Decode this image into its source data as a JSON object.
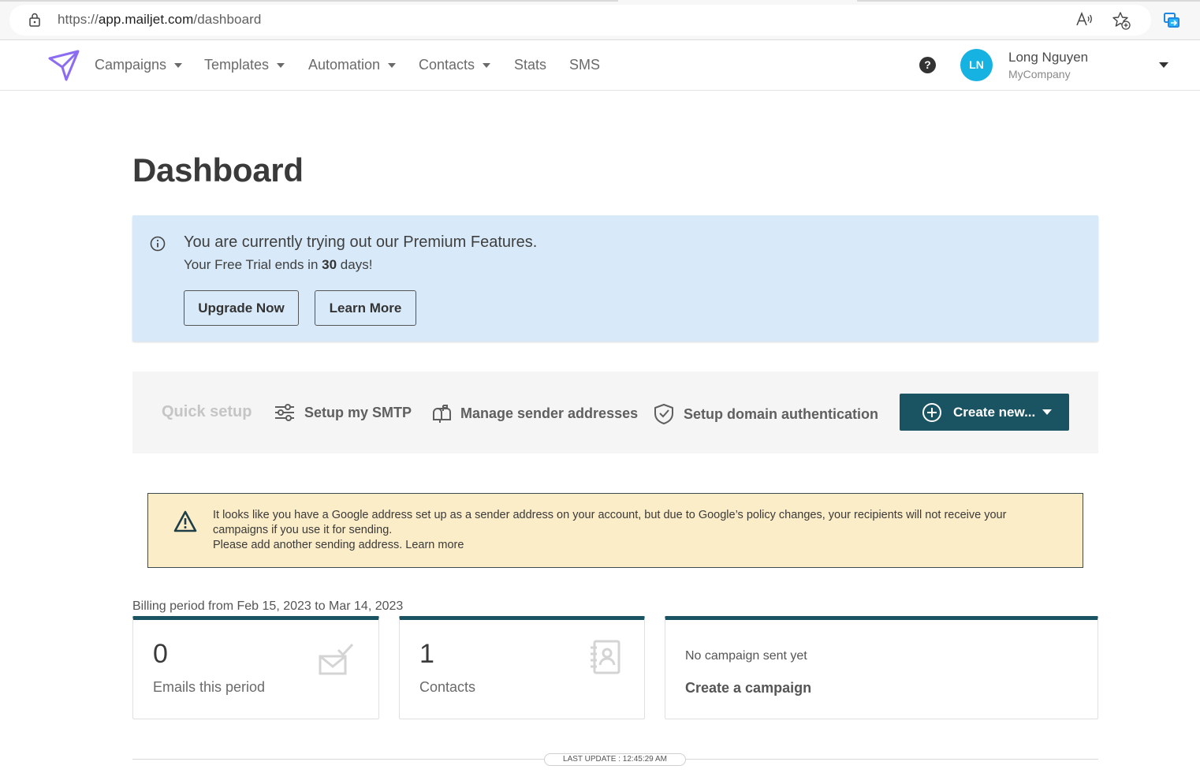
{
  "browser": {
    "url_scheme": "https://",
    "url_domain": "app.mailjet.com",
    "url_path": "/dashboard",
    "icons": [
      "lock-icon",
      "read-aloud-icon",
      "add-favorite-icon",
      "extension-icon"
    ]
  },
  "nav": {
    "items": [
      {
        "label": "Campaigns",
        "dropdown": true
      },
      {
        "label": "Templates",
        "dropdown": true
      },
      {
        "label": "Automation",
        "dropdown": true
      },
      {
        "label": "Contacts",
        "dropdown": true
      },
      {
        "label": "Stats",
        "dropdown": false
      },
      {
        "label": "SMS",
        "dropdown": false
      }
    ],
    "help_glyph": "?",
    "user": {
      "initials": "LN",
      "name": "Long Nguyen",
      "company": "MyCompany"
    },
    "brand_color": "#8c6cf0",
    "avatar_color": "#15b2e2"
  },
  "page": {
    "title": "Dashboard"
  },
  "premium": {
    "title": "You are currently trying out our Premium Features.",
    "sub_prefix": "Your Free Trial ends in ",
    "sub_days": "30",
    "sub_suffix": " days!",
    "upgrade_label": "Upgrade Now",
    "learn_label": "Learn More",
    "bg_color": "#d8eaf9"
  },
  "quick_setup": {
    "label": "Quick setup",
    "items": [
      {
        "label": "Setup my SMTP",
        "icon": "sliders-icon"
      },
      {
        "label": "Manage sender addresses",
        "icon": "mailbox-icon"
      },
      {
        "label": "Setup domain authentication",
        "icon": "shield-check-icon"
      }
    ],
    "create_label": "Create new...",
    "create_color": "#1a5361"
  },
  "warning": {
    "line1": "It looks like you have a Google address set up as a sender address on your account, but due to Google’s policy changes, your recipients will not receive your campaigns if you use it for sending.",
    "line2_prefix": "Please add another sending address. ",
    "line2_link": "Learn more",
    "bg_color": "#fcedc9"
  },
  "billing": {
    "period": "Billing period from Feb 15, 2023 to Mar 14, 2023",
    "cards": [
      {
        "value": "0",
        "label": "Emails this period",
        "icon": "email-check-icon"
      },
      {
        "value": "1",
        "label": "Contacts",
        "icon": "contact-book-icon"
      }
    ],
    "campaign_card": {
      "note": "No campaign sent yet",
      "link": "Create a campaign"
    }
  },
  "footer": {
    "last_update": "LAST UPDATE : 12:45:29 AM"
  }
}
